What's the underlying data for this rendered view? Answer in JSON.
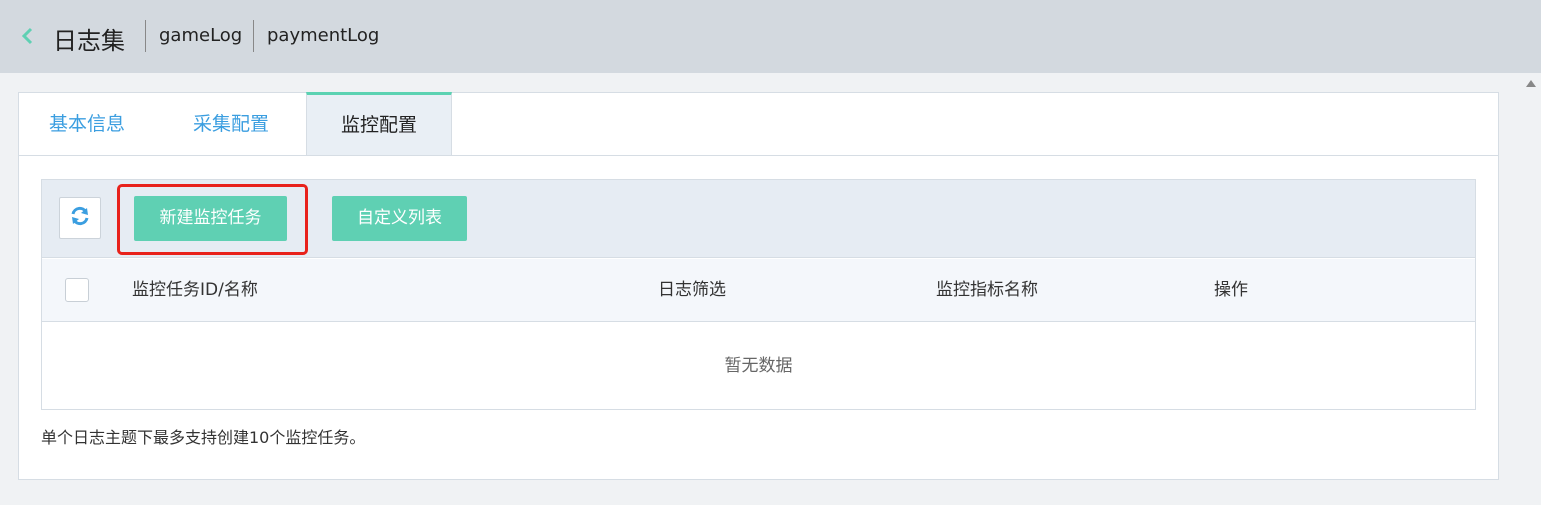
{
  "header": {
    "title": "日志集",
    "breadcrumbs": [
      "gameLog",
      "paymentLog"
    ]
  },
  "tabs": [
    {
      "label": "基本信息",
      "active": false
    },
    {
      "label": "采集配置",
      "active": false
    },
    {
      "label": "监控配置",
      "active": true
    }
  ],
  "toolbar": {
    "refresh_icon": "refresh-icon",
    "new_task_label": "新建监控任务",
    "custom_list_label": "自定义列表"
  },
  "table": {
    "columns": [
      "监控任务ID/名称",
      "日志筛选",
      "监控指标名称",
      "操作"
    ],
    "empty_text": "暂无数据"
  },
  "note": "单个日志主题下最多支持创建10个监控任务。",
  "colors": {
    "accent": "#5fd0b3",
    "link": "#3b9ee0",
    "highlight": "#e8221b",
    "topbar": "#d3d9df"
  }
}
